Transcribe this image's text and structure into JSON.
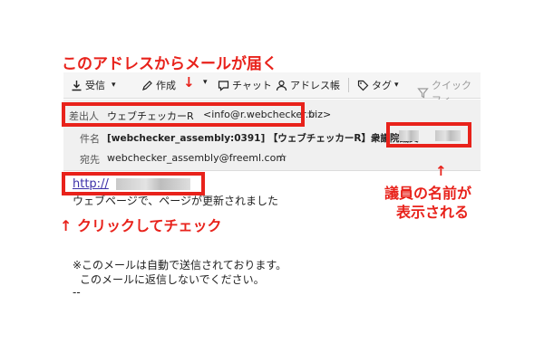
{
  "annotations": {
    "top": "このアドレスからメールが届く",
    "click": "↑ クリックしてチェック",
    "name_arrow": "↑",
    "name_line1": "議員の名前が",
    "name_line2": "表示される",
    "toolbar_arrow": "↓"
  },
  "toolbar": {
    "receive": "受信",
    "compose": "作成",
    "chat": "チャット",
    "address_book": "アドレス帳",
    "tag": "タグ",
    "quickfilter": "クイックフィ"
  },
  "header": {
    "from_label": "差出人",
    "from_name": "ウェブチェッカーR",
    "from_email": "<info@r.webchecker.biz>",
    "subject_label": "件名",
    "subject_value": "[webchecker_assembly:0391] 【ウェブチェッカーR】衆議院議員",
    "to_label": "宛先",
    "to_value": "webchecker_assembly@freeml.com"
  },
  "body": {
    "link": "http://",
    "line1": "ウェブページで、ページが更新されました",
    "note1": "※このメールは自動で送信されております。",
    "note2": "このメールに返信しないでください。",
    "sig": "--"
  },
  "colors": {
    "annotation": "#e8221b",
    "link": "#3b2fa8"
  }
}
